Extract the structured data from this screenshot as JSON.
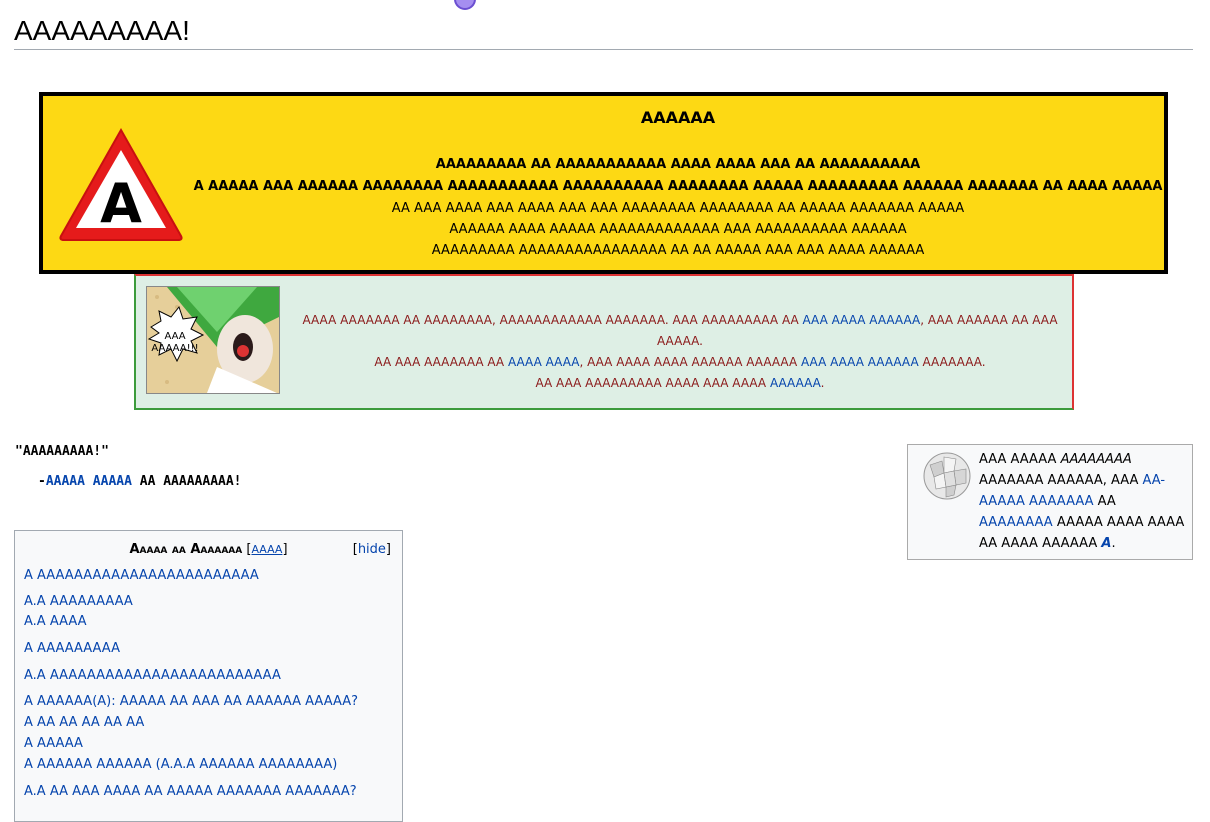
{
  "page": {
    "title": "AAAAAAAAA!"
  },
  "warning": {
    "sign_letter": "A",
    "heading": "AAAAAA",
    "bold_lines": [
      "AAAAAAAAA AA AAAAAAAAAAA AAAA AAAA AAA AA AAAAAAAAAA",
      "A AAAAA AAA AAAAAA AAAAAAAA AAAAAAAAAAA AAAAAAAAAA AAAAAAAA AAAAA AAAAAAAAA AAAAAA AAAAAAA AA AAAA AAAAA"
    ],
    "lines": [
      "AA AAA AAAA AAA AAAA AAA AAA AAAAAAAA AAAAAAAA AA AAAAA AAAAAAA AAAAA",
      "AAAAAA AAAA AAAAA AAAAAAAAAAAAA AAA AAAAAAAAAA AAAAAA",
      "AAAAAAAAA AAAAAAAAAAAAAAAA AA AA AAAAA AAA AAA AAAA AAAAAA"
    ]
  },
  "notice": {
    "image_caption_1": "AAA",
    "image_caption_2": "AAAAA!!!",
    "line1_a": "AAAA AAAAAAA AA AAAAAAAA, AAAAAAAAAAAA AAAAAAA.  AAA AAAAAAAAA AA ",
    "line1_link": "AAA AAAA AAAAAA",
    "line1_b": ", AAA AAAAAA AA AAA AAAAA.",
    "line2_a": "AA AAA AAAAAAA AA ",
    "line2_link1": "AAAA AAAA",
    "line2_b": ", AAA AAAA AAAA AAAAAA AAAAAA ",
    "line2_link2": "AAA AAAA AAAAAA",
    "line2_c": " AAAAAAA.",
    "line3_a": "AA AAA AAAAAAAAA AAAA AAA AAAA ",
    "line3_link": "AAAAAA",
    "line3_b": "."
  },
  "quote": {
    "text": "\"AAAAAAAAA!\"",
    "dash": "-",
    "author_link": "AAAAA AAAAA",
    "suffix": " AA AAAAAAAAA!"
  },
  "wiki": {
    "t1": "AAA AAAAA ",
    "t1_italic": "AAAAAAAA",
    "t2": " AAAAAAA AAAAAA, AAA ",
    "link1": "AA-AAAAA AAAAAAA",
    "t3": " AA ",
    "link2": "AAAAAAAA",
    "t4": " AAAAA AAAA AAAA AA AAAA AAAAAA ",
    "link3": "A",
    "t5": "."
  },
  "toc": {
    "title": "Aaaaa aa Aaaaaaa",
    "title_link": "AAAA",
    "hide_label": "hide",
    "items": [
      "A AAAAAAAAAAAAAAAAAAAAAAAA",
      "A.A AAAAAAAAA",
      "A.A AAAA",
      "A AAAAAAAAA",
      "A.A AAAAAAAAAAAAAAAAAAAAAAAAA",
      "A AAAAAA(A): AAAAA AA AAA AA AAAAAA AAAAA?",
      "A AA AA AA AA AA",
      "A AAAAA",
      "A AAAAAA AAAAAA (A.A.A AAAAAA AAAAAAAA)",
      "A.A AA AAA AAAA AA AAAAA AAAAAAA AAAAAAA?"
    ]
  },
  "colors": {
    "warning_bg": "#fdd914",
    "notice_bg": "#deefe5",
    "link": "#0645ad",
    "notice_text": "#8b1a1a"
  }
}
